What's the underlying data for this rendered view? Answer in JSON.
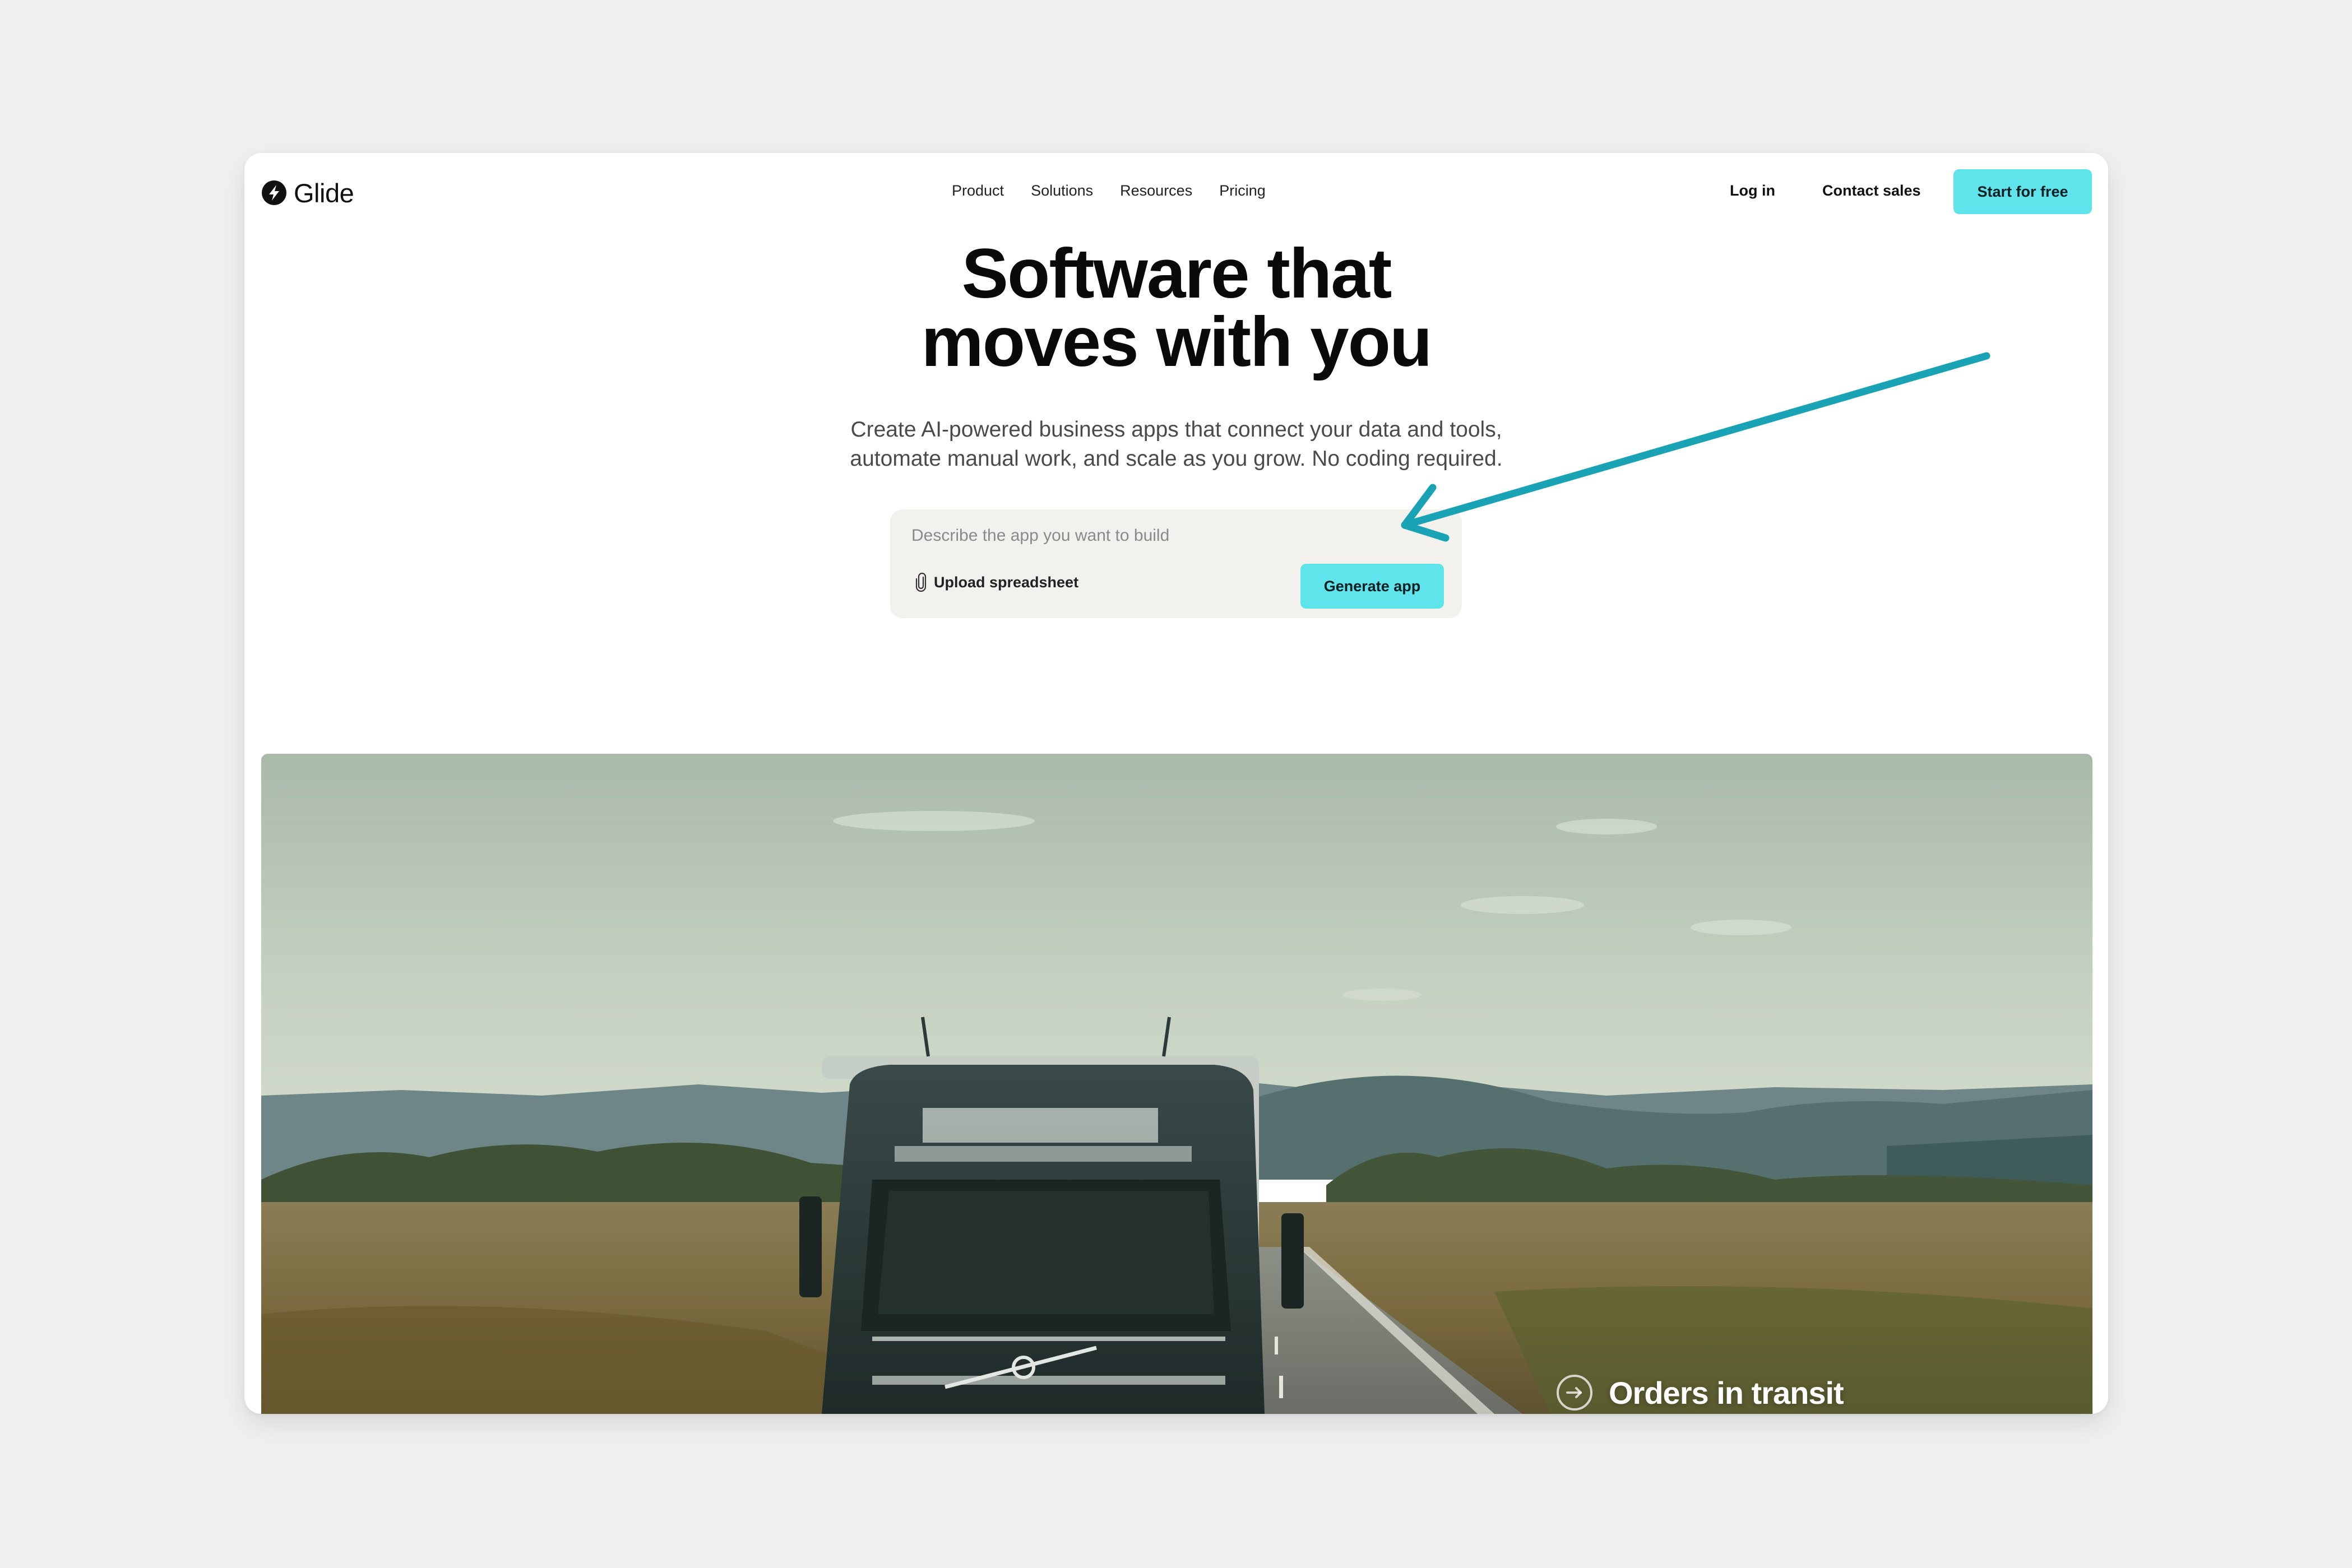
{
  "brand": {
    "name": "Glide",
    "logo_icon": "glide-bolt-icon"
  },
  "nav": {
    "links": [
      "Product",
      "Solutions",
      "Resources",
      "Pricing"
    ],
    "login_label": "Log in",
    "contact_label": "Contact sales",
    "cta_label": "Start for free"
  },
  "hero": {
    "title_line1": "Software that",
    "title_line2": "moves with you",
    "subtitle_line1": "Create AI-powered business apps that connect your data and tools,",
    "subtitle_line2": "automate manual work, and scale as you grow. No coding required."
  },
  "prompt": {
    "placeholder": "Describe the app you want to build",
    "value": "",
    "upload_label": "Upload spreadsheet",
    "upload_icon": "paperclip-icon",
    "generate_label": "Generate app"
  },
  "media": {
    "caption": "Orders in transit",
    "caption_icon": "arrow-circle-icon"
  },
  "colors": {
    "accent": "#5ee4ea",
    "annotation_arrow": "#1aa3b5",
    "page_background": "#f0f0f0",
    "prompt_background": "#f2f1ee"
  }
}
